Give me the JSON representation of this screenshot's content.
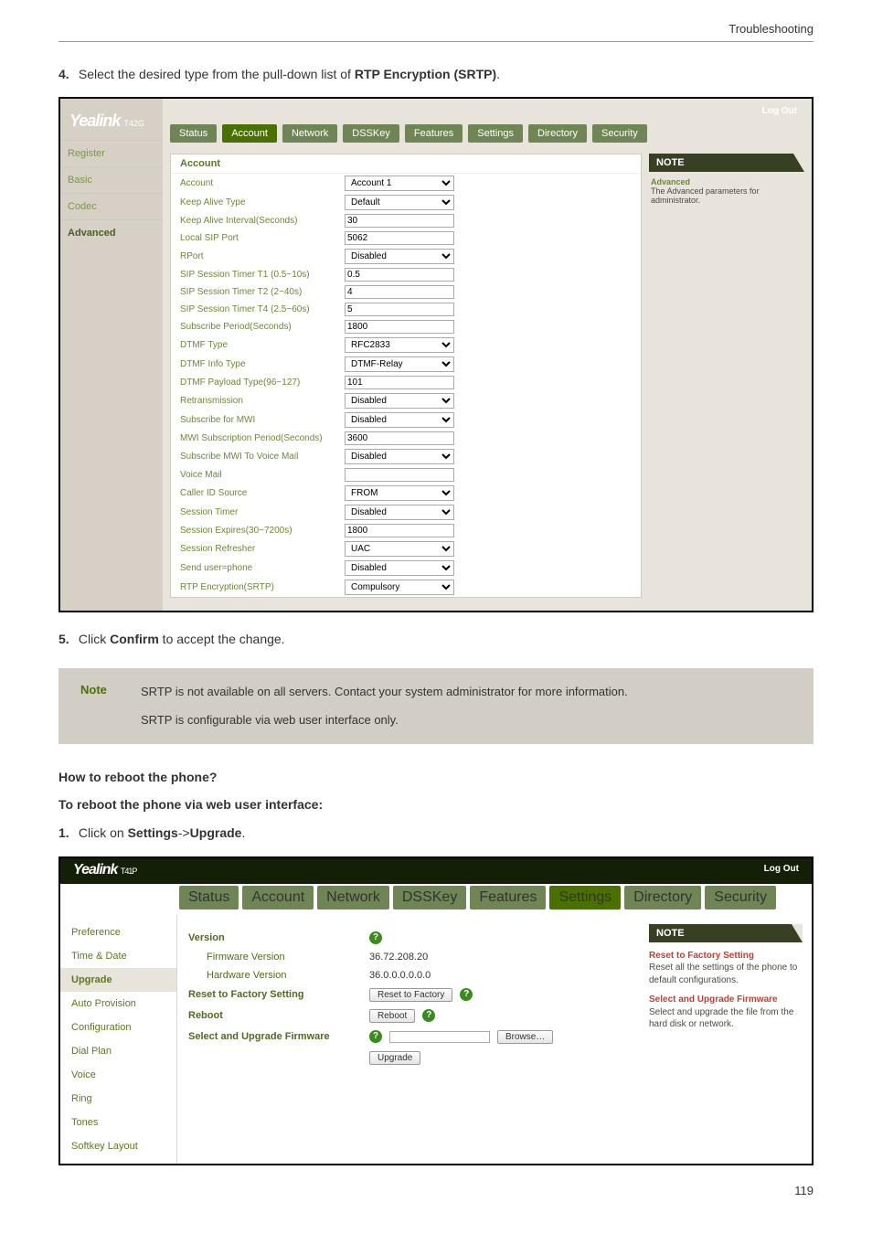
{
  "header": {
    "title": "Troubleshooting"
  },
  "step4": {
    "num": "4.",
    "prefix": "Select the desired type from the pull-down list of ",
    "bold": "RTP Encryption (SRTP)",
    "suffix": "."
  },
  "shot1": {
    "brand": "Yealink",
    "model": "T42G",
    "logout": "Log Out",
    "top_tabs": {
      "status": "Status",
      "account": "Account",
      "network": "Network",
      "dsskey": "DSSKey",
      "features": "Features",
      "settings": "Settings",
      "directory": "Directory",
      "security": "Security"
    },
    "side_tabs": {
      "register": "Register",
      "basic": "Basic",
      "codec": "Codec",
      "advanced": "Advanced"
    },
    "kv_header": "Account",
    "rows": [
      {
        "k": "Account",
        "v": "Account 1",
        "type": "select"
      },
      {
        "k": "Keep Alive Type",
        "v": "Default",
        "type": "select"
      },
      {
        "k": "Keep Alive Interval(Seconds)",
        "v": "30",
        "type": "text"
      },
      {
        "k": "Local SIP Port",
        "v": "5062",
        "type": "text"
      },
      {
        "k": "RPort",
        "v": "Disabled",
        "type": "select"
      },
      {
        "k": "SIP Session Timer T1 (0.5~10s)",
        "v": "0.5",
        "type": "text"
      },
      {
        "k": "SIP Session Timer T2 (2~40s)",
        "v": "4",
        "type": "text"
      },
      {
        "k": "SIP Session Timer T4 (2.5~60s)",
        "v": "5",
        "type": "text"
      },
      {
        "k": "Subscribe Period(Seconds)",
        "v": "1800",
        "type": "text"
      },
      {
        "k": "DTMF Type",
        "v": "RFC2833",
        "type": "select"
      },
      {
        "k": "DTMF Info Type",
        "v": "DTMF-Relay",
        "type": "select"
      },
      {
        "k": "DTMF Payload Type(96~127)",
        "v": "101",
        "type": "text"
      },
      {
        "k": "Retransmission",
        "v": "Disabled",
        "type": "select"
      },
      {
        "k": "Subscribe for MWI",
        "v": "Disabled",
        "type": "select"
      },
      {
        "k": "MWI Subscription Period(Seconds)",
        "v": "3600",
        "type": "text"
      },
      {
        "k": "Subscribe MWI To Voice Mail",
        "v": "Disabled",
        "type": "select"
      },
      {
        "k": "Voice Mail",
        "v": "",
        "type": "text"
      },
      {
        "k": "Caller ID Source",
        "v": "FROM",
        "type": "select"
      },
      {
        "k": "Session Timer",
        "v": "Disabled",
        "type": "select"
      },
      {
        "k": "Session Expires(30~7200s)",
        "v": "1800",
        "type": "text"
      },
      {
        "k": "Session Refresher",
        "v": "UAC",
        "type": "select"
      },
      {
        "k": "Send user=phone",
        "v": "Disabled",
        "type": "select"
      },
      {
        "k": "RTP Encryption(SRTP)",
        "v": "Compulsory",
        "type": "select"
      }
    ],
    "note_box": "NOTE",
    "note_title": "Advanced",
    "note_body": "The Advanced parameters for administrator."
  },
  "step5": {
    "num": "5.",
    "prefix": "Click ",
    "bold": "Confirm",
    "suffix": " to accept the change."
  },
  "docnote": {
    "label": "Note",
    "line1": "SRTP is not available on all servers. Contact your system administrator for more information.",
    "line2": "SRTP is configurable via web user interface only."
  },
  "section": {
    "q": "How to reboot the phone?",
    "sub": "To reboot the phone via web user interface:",
    "step1": {
      "num": "1.",
      "prefix": "Click on ",
      "b1": "Settings",
      "mid": "->",
      "b2": "Upgrade",
      "suffix": "."
    }
  },
  "shot2": {
    "brand": "Yealink",
    "model": "T41P",
    "logout": "Log Out",
    "top_tabs": {
      "status": "Status",
      "account": "Account",
      "network": "Network",
      "dsskey": "DSSKey",
      "features": "Features",
      "settings": "Settings",
      "directory": "Directory",
      "security": "Security"
    },
    "side": [
      "Preference",
      "Time & Date",
      "Upgrade",
      "Auto Provision",
      "Configuration",
      "Dial Plan",
      "Voice",
      "Ring",
      "Tones",
      "Softkey Layout"
    ],
    "side_active": "Upgrade",
    "main": {
      "version_label": "Version",
      "fw_label": "Firmware Version",
      "fw_val": "36.72.208.20",
      "hw_label": "Hardware Version",
      "hw_val": "36.0.0.0.0.0.0",
      "reset_label": "Reset to Factory Setting",
      "reset_btn": "Reset to Factory",
      "reboot_label": "Reboot",
      "reboot_btn": "Reboot",
      "sel_label": "Select and Upgrade Firmware",
      "browse": "Browse…",
      "upgrade_btn": "Upgrade"
    },
    "note": {
      "box": "NOTE",
      "b1_title": "Reset to Factory Setting",
      "b1_body": "Reset all the settings of the phone to default configurations.",
      "b2_title": "Select and Upgrade Firmware",
      "b2_body": "Select and upgrade the file from the hard disk or network."
    }
  },
  "page_number": "119"
}
